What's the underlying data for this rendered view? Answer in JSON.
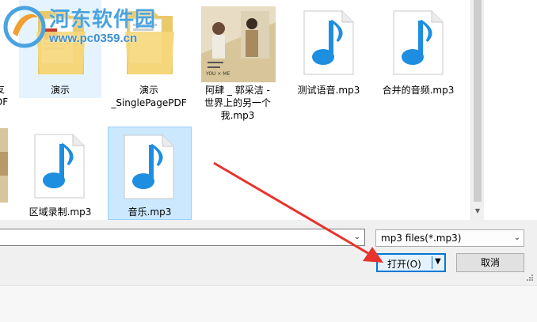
{
  "watermark": {
    "title": "河东软件园",
    "url": "www.pc0359.cn"
  },
  "files_row1": [
    {
      "label_lines": [
        "友",
        "DF"
      ]
    },
    {
      "label_lines": [
        "演示"
      ]
    },
    {
      "label_lines": [
        "演示",
        "_SinglePagePDF"
      ]
    },
    {
      "label_lines": [
        "阿肆 _ 郭采洁 -",
        "世界上的另一个",
        "我.mp3"
      ],
      "art_text": "YOU × ME"
    },
    {
      "label_lines": [
        "测试语音.mp3"
      ]
    },
    {
      "label_lines": [
        "合并的音频.mp3"
      ]
    }
  ],
  "files_row2": [
    {
      "label_lines": [
        "区域录制.mp3"
      ]
    },
    {
      "label_lines": [
        "音乐.mp3"
      ]
    }
  ],
  "footer": {
    "file_type": "mp3 files(*.mp3)",
    "open_label": "打开(O)",
    "cancel_label": "取消"
  },
  "colors": {
    "accent": "#0078d7",
    "note_blue": "#1e8ee0",
    "arrow_red": "#e8322d",
    "selection": "#cce8ff"
  }
}
